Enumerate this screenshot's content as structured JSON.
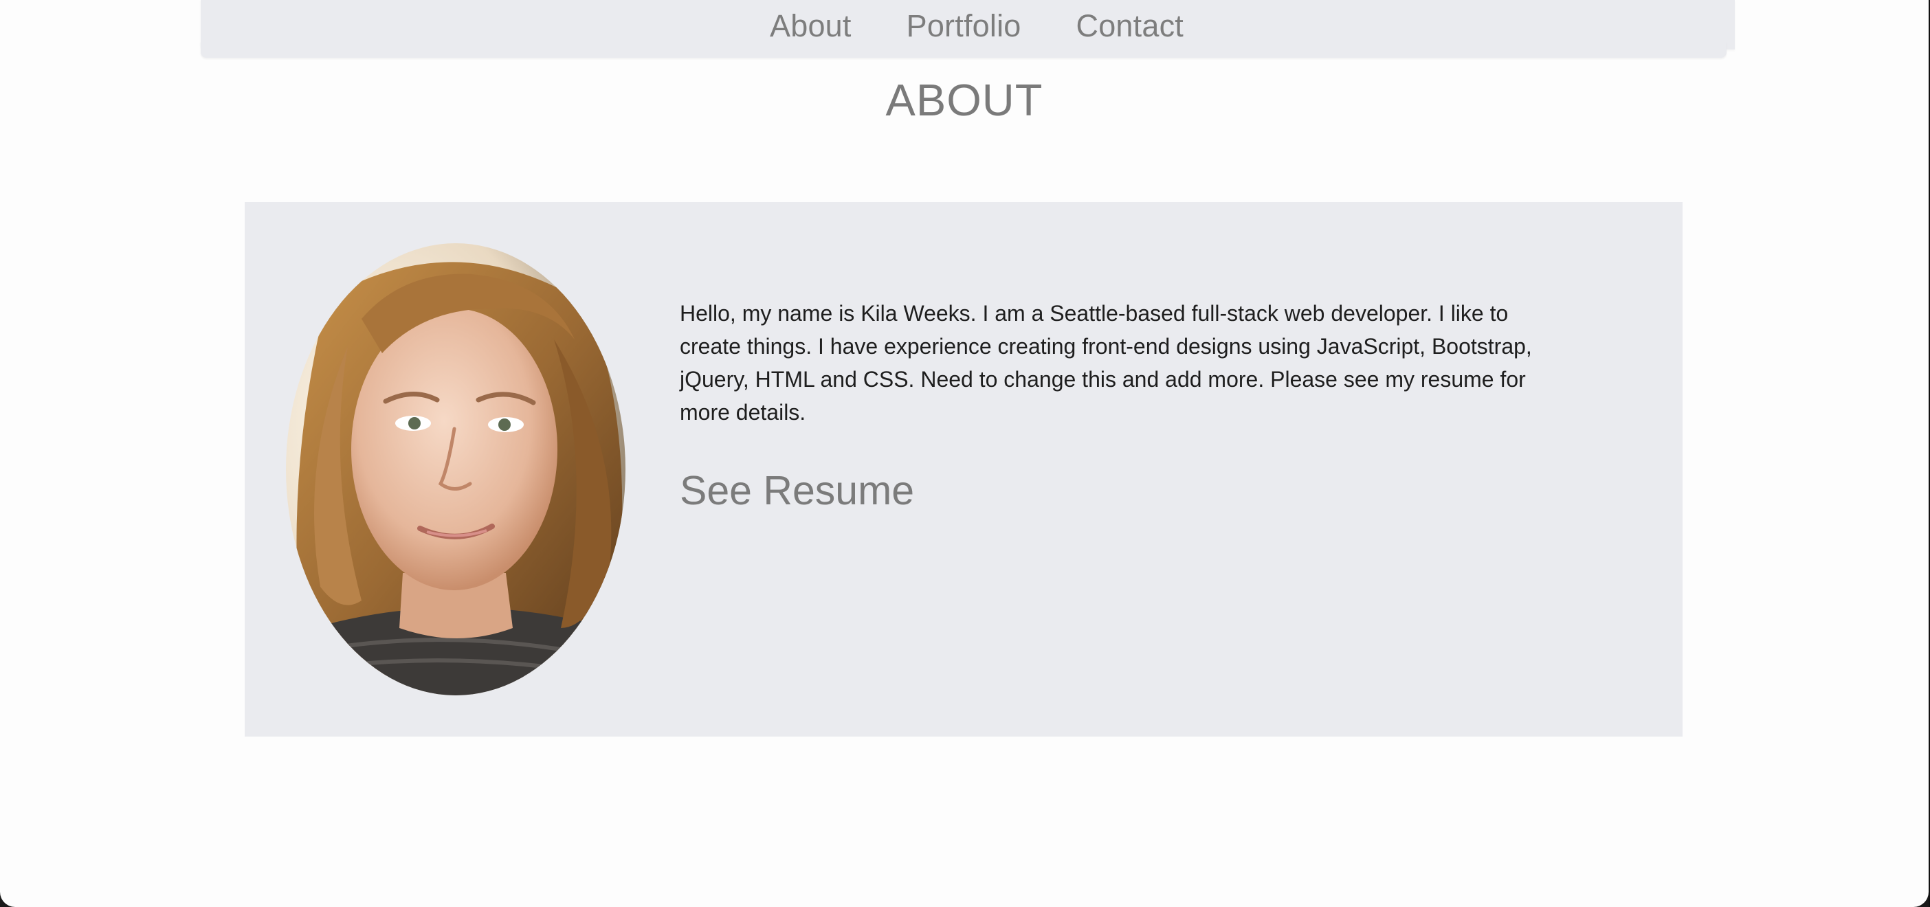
{
  "nav": {
    "items": [
      {
        "label": "About"
      },
      {
        "label": "Portfolio"
      },
      {
        "label": "Contact"
      }
    ]
  },
  "main": {
    "section_title": "ABOUT",
    "bio": "Hello, my name is Kila Weeks. I am a Seattle-based full-stack web developer. I like to create things. I have experience creating front-end designs using JavaScript, Bootstrap, jQuery, HTML and CSS. Need to change this and add more. Please see my resume for more details.",
    "resume_label": "See Resume"
  },
  "colors": {
    "page_background": "#fdfdfd",
    "nav_background": "#eaebef",
    "card_background": "#eaebef",
    "muted_text": "#7d7d7d",
    "body_text": "#1e1e1e"
  }
}
